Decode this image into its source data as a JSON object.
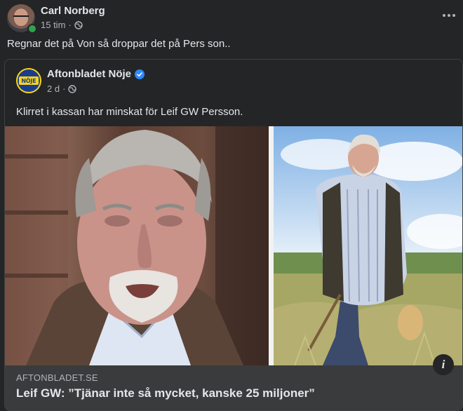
{
  "post": {
    "author": "Carl Norberg",
    "time": "15 tim",
    "separator": "·",
    "text": "Regnar det på Von så droppar det på Pers son.."
  },
  "shared": {
    "page_name": "Aftonbladet Nöje",
    "avatar_text": "NÖJE",
    "time": "2 d",
    "separator": "·",
    "text": "Klirret i kassan har minskat för Leif GW Persson."
  },
  "link": {
    "domain": "AFTONBLADET.SE",
    "title": "Leif GW: ”Tjänar inte så mycket, kanske 25 miljoner”",
    "info_label": "i"
  },
  "icons": {
    "more": "more-horizontal-icon",
    "audience": "globe-icon",
    "verified": "verified-badge-icon",
    "info": "info-icon"
  },
  "colors": {
    "background": "#242526",
    "link_footer": "#3a3b3c",
    "verified": "#2d88ff",
    "online": "#31a24c"
  }
}
